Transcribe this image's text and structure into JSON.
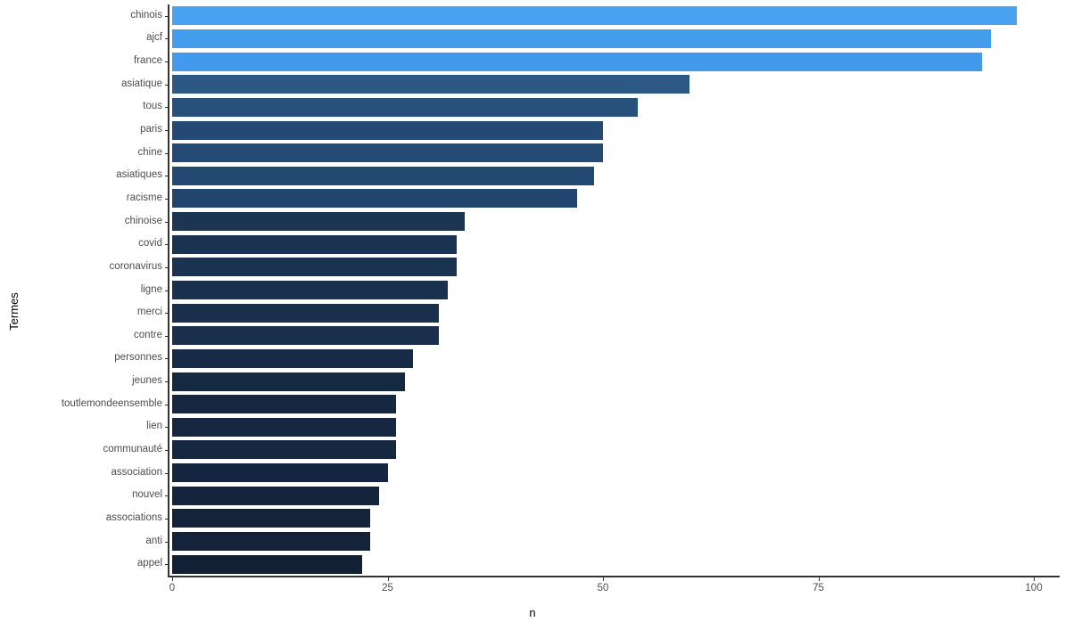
{
  "chart_data": {
    "type": "bar",
    "orientation": "horizontal",
    "title": "",
    "xlabel": "n",
    "ylabel": "Termes",
    "xlim": [
      0,
      100
    ],
    "xticks": [
      0,
      25,
      50,
      75,
      100
    ],
    "grid": false,
    "legend": "none",
    "fill_scale": {
      "mapped_to": "n",
      "low_color": "#121f33",
      "high_color": "#4aa3f0"
    },
    "categories": [
      "chinois",
      "ajcf",
      "france",
      "asiatique",
      "tous",
      "paris",
      "chine",
      "asiatiques",
      "racisme",
      "chinoise",
      "covid",
      "coronavirus",
      "ligne",
      "merci",
      "contre",
      "personnes",
      "jeunes",
      "toutlemondeensemble",
      "lien",
      "communauté",
      "association",
      "nouvel",
      "associations",
      "anti",
      "appel"
    ],
    "values": [
      98,
      95,
      94,
      60,
      54,
      50,
      50,
      49,
      47,
      34,
      33,
      33,
      32,
      31,
      31,
      28,
      27,
      26,
      26,
      26,
      25,
      24,
      23,
      23,
      22
    ],
    "bar_colors": [
      "#4aa3f0",
      "#459ded",
      "#4399eb",
      "#2b5984",
      "#27507a",
      "#244a73",
      "#244a73",
      "#234872",
      "#22456e",
      "#1b3553",
      "#1a3350",
      "#1a3350",
      "#19314e",
      "#192f4b",
      "#192f4b",
      "#172b46",
      "#162943",
      "#162841",
      "#162841",
      "#162841",
      "#152640",
      "#14243d",
      "#14223a",
      "#14223a",
      "#122036"
    ]
  }
}
